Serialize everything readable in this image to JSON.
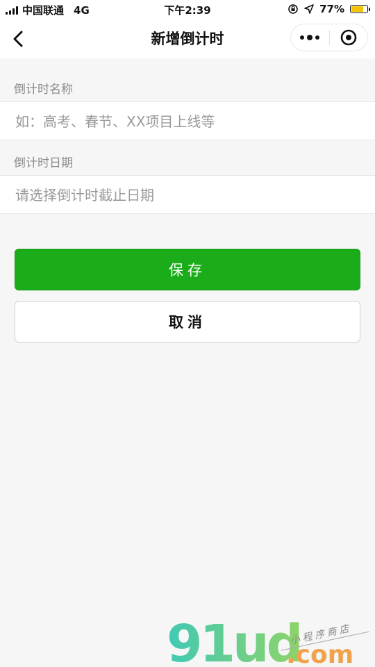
{
  "status_bar": {
    "carrier": "中国联通",
    "network": "4G",
    "time": "下午2:39",
    "battery_percent": "77%",
    "battery_level": 0.77,
    "battery_color": "#f5c400",
    "icons": [
      "signal-bars-icon",
      "orientation-lock-icon",
      "location-arrow-icon",
      "battery-icon"
    ]
  },
  "nav": {
    "title": "新增倒计时",
    "back_icon": "chevron-left-icon",
    "menu_icon": "more-dots-icon",
    "close_icon": "target-close-icon"
  },
  "form": {
    "name_label": "倒计时名称",
    "name_placeholder": "如：高考、春节、XX项目上线等",
    "name_value": "",
    "date_label": "倒计时日期",
    "date_placeholder": "请选择倒计时截止日期",
    "date_value": ""
  },
  "buttons": {
    "save_label": "保存",
    "cancel_label": "取消"
  },
  "colors": {
    "primary": "#1aad19",
    "background": "#f6f6f6",
    "label": "#8a8a8a",
    "placeholder": "#9a9a9a"
  },
  "watermark": {
    "brand": "91ud",
    "domain": ".com",
    "slogan": "小程序商店"
  }
}
